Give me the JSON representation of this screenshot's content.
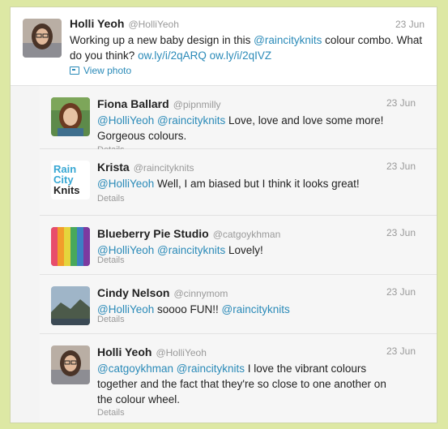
{
  "main": {
    "name": "Holli Yeoh",
    "handle": "@HolliYeoh",
    "time": "23 Jun",
    "text_1": "Working up a new baby design in this ",
    "mention_1": "@raincityknits",
    "text_2": " colour combo. What do you think? ",
    "link_1": "ow.ly/i/2qARQ",
    "link_2": "ow.ly/i/2qIVZ",
    "view_photo": "View photo"
  },
  "replies": [
    {
      "name": "Fiona Ballard",
      "handle": "@pipnmilly",
      "time": "23 Jun",
      "m1": "@HolliYeoh",
      "m2": "@raincityknits",
      "text": " Love, love and love some more! Gorgeous colours.",
      "details": "Details"
    },
    {
      "name": "Krista",
      "handle": "@raincityknits",
      "time": "23 Jun",
      "m1": "@HolliYeoh",
      "text": " Well, I am biased but I think it looks great!",
      "details": "Details",
      "logo_text": [
        "Rain",
        "City",
        "Knits"
      ]
    },
    {
      "name": "Blueberry Pie Studio",
      "handle": "@catgoykhman",
      "time": "23 Jun",
      "m1": "@HolliYeoh",
      "m2": "@raincityknits",
      "text": " Lovely!",
      "details": "Details"
    },
    {
      "name": "Cindy Nelson",
      "handle": "@cinnymom",
      "time": "23 Jun",
      "m1": "@HolliYeoh",
      "text_mid": " soooo FUN!! ",
      "m2": "@raincityknits",
      "details": "Details"
    },
    {
      "name": "Holli Yeoh",
      "handle": "@HolliYeoh",
      "time": "23 Jun",
      "m1": "@catgoykhman",
      "m2": "@raincityknits",
      "text": " I love the vibrant colours together and the fact that they're so close to one another on the colour wheel.",
      "details": "Details"
    }
  ]
}
